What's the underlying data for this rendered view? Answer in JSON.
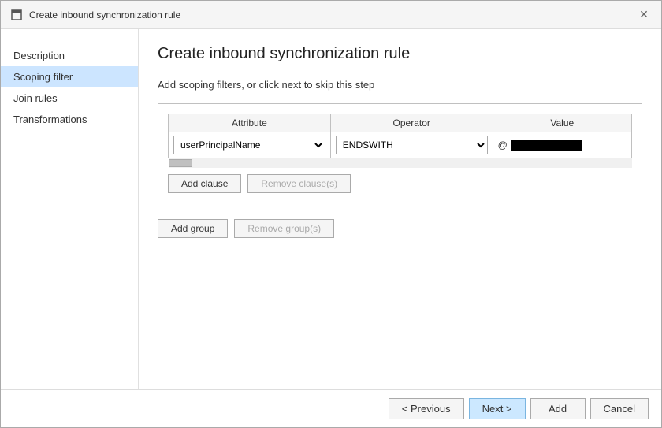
{
  "window": {
    "title": "Create inbound synchronization rule",
    "close_label": "✕"
  },
  "page": {
    "title": "Create inbound synchronization rule",
    "step_description": "Add scoping filters, or click next to skip this step"
  },
  "sidebar": {
    "items": [
      {
        "id": "description",
        "label": "Description",
        "active": false
      },
      {
        "id": "scoping-filter",
        "label": "Scoping filter",
        "active": true
      },
      {
        "id": "join-rules",
        "label": "Join rules",
        "active": false
      },
      {
        "id": "transformations",
        "label": "Transformations",
        "active": false
      }
    ]
  },
  "filter": {
    "columns": {
      "attribute": "Attribute",
      "operator": "Operator",
      "value": "Value"
    },
    "row": {
      "attribute_value": "userPrincipalName",
      "operator_value": "ENDSWITH",
      "value_prefix": "@"
    },
    "attribute_options": [
      "userPrincipalName"
    ],
    "operator_options": [
      "ENDSWITH"
    ]
  },
  "buttons": {
    "add_clause": "Add clause",
    "remove_clause": "Remove clause(s)",
    "add_group": "Add group",
    "remove_group": "Remove group(s)"
  },
  "footer": {
    "previous": "< Previous",
    "next": "Next >",
    "add": "Add",
    "cancel": "Cancel"
  }
}
